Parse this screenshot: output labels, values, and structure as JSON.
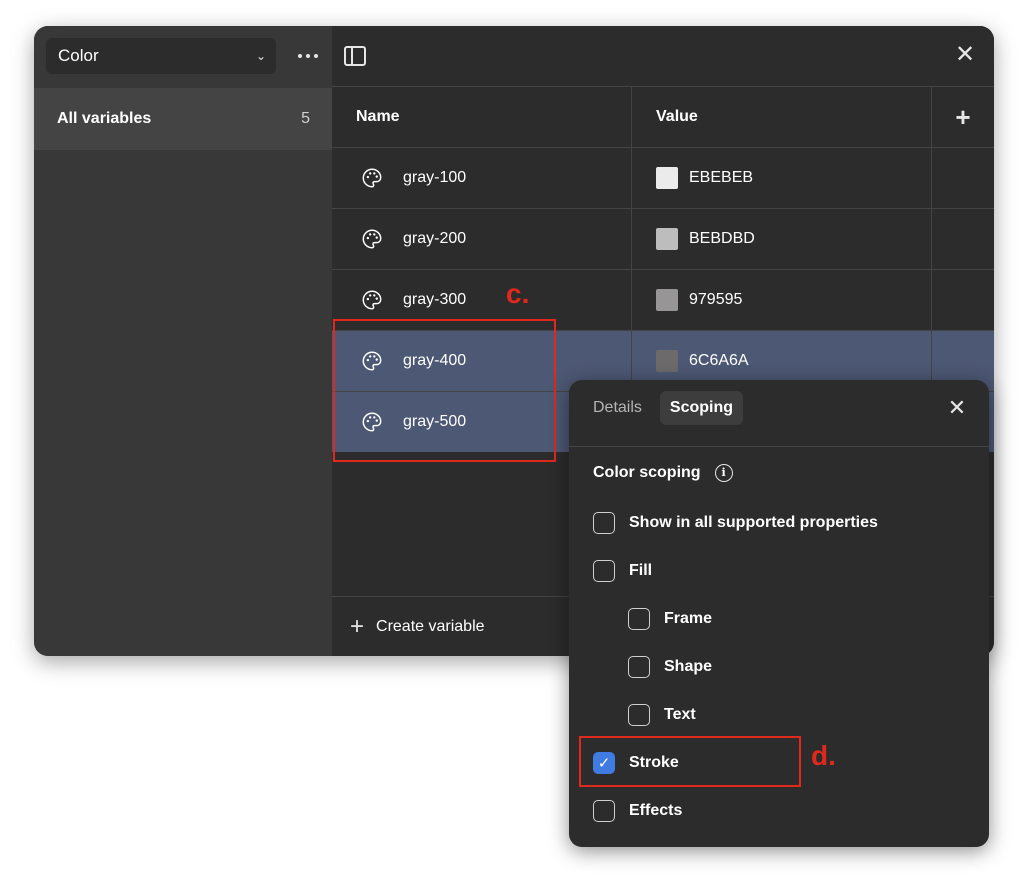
{
  "sidebar": {
    "collection_select": {
      "value": "Color"
    },
    "groups": [
      {
        "label": "All variables",
        "count": "5"
      }
    ]
  },
  "table": {
    "headers": {
      "name": "Name",
      "value": "Value"
    },
    "rows": [
      {
        "name": "gray-100",
        "value": "EBEBEB",
        "swatch": "#EBEBEB",
        "selected": false
      },
      {
        "name": "gray-200",
        "value": "BEBDBD",
        "swatch": "#BEBDBD",
        "selected": false
      },
      {
        "name": "gray-300",
        "value": "979595",
        "swatch": "#979595",
        "selected": false
      },
      {
        "name": "gray-400",
        "value": "6C6A6A",
        "swatch": "#6C6A6A",
        "selected": true
      },
      {
        "name": "gray-500",
        "value": "",
        "swatch": "",
        "selected": true
      }
    ],
    "create_label": "Create variable"
  },
  "annotations": {
    "c": "c.",
    "d": "d.",
    "color": "#E0281C"
  },
  "popover": {
    "tabs": [
      {
        "label": "Details",
        "active": false
      },
      {
        "label": "Scoping",
        "active": true
      }
    ],
    "heading": "Color scoping",
    "options": [
      {
        "label": "Show in all supported properties",
        "checked": false,
        "indent": 0
      },
      {
        "label": "Fill",
        "checked": false,
        "indent": 0
      },
      {
        "label": "Frame",
        "checked": false,
        "indent": 1
      },
      {
        "label": "Shape",
        "checked": false,
        "indent": 1
      },
      {
        "label": "Text",
        "checked": false,
        "indent": 1
      },
      {
        "label": "Stroke",
        "checked": true,
        "indent": 0
      },
      {
        "label": "Effects",
        "checked": false,
        "indent": 0
      }
    ]
  },
  "colors": {
    "window_bg": "#2C2C2C",
    "sidebar_bg": "#383838",
    "selected_row": "#4D5874",
    "accent": "#3F7BE0"
  }
}
